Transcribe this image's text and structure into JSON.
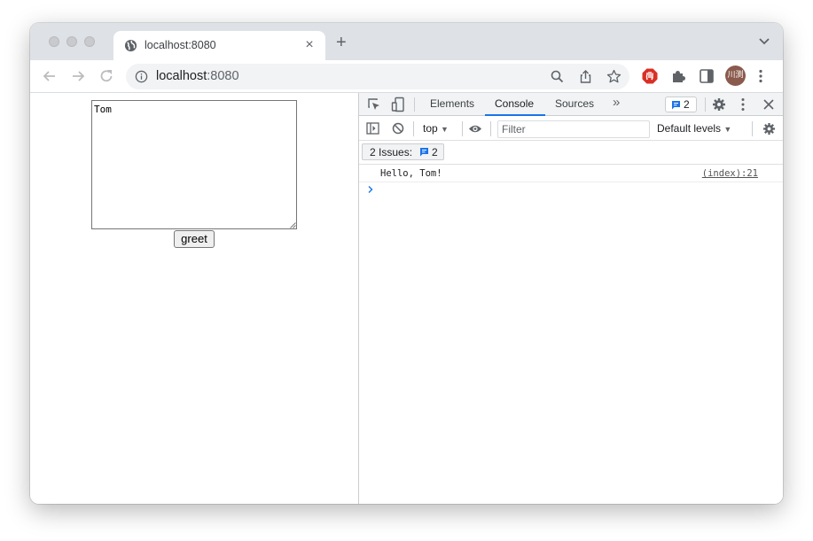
{
  "browser": {
    "tab": {
      "title": "localhost:8080",
      "close": "×"
    },
    "new_tab": "+",
    "omnibox": {
      "host": "localhost",
      "port": ":8080"
    },
    "avatar_text": "川渕"
  },
  "page": {
    "textarea_value": "Tom",
    "greet_button": "greet"
  },
  "devtools": {
    "tabs": [
      "Elements",
      "Console",
      "Sources"
    ],
    "active_tab": "Console",
    "more_tabs": "»",
    "messages_badge_count": "2",
    "context": "top",
    "filter_placeholder": "Filter",
    "levels": "Default levels",
    "issues": {
      "label": "2 Issues:",
      "count": "2"
    },
    "console_messages": [
      {
        "text": "Hello, Tom!",
        "source": "(index):21"
      }
    ]
  },
  "colors": {
    "accent": "#1a73e8",
    "tabstrip": "#dee1e6",
    "devtools_bar": "#f1f3f4",
    "adblock": "#d93025"
  }
}
